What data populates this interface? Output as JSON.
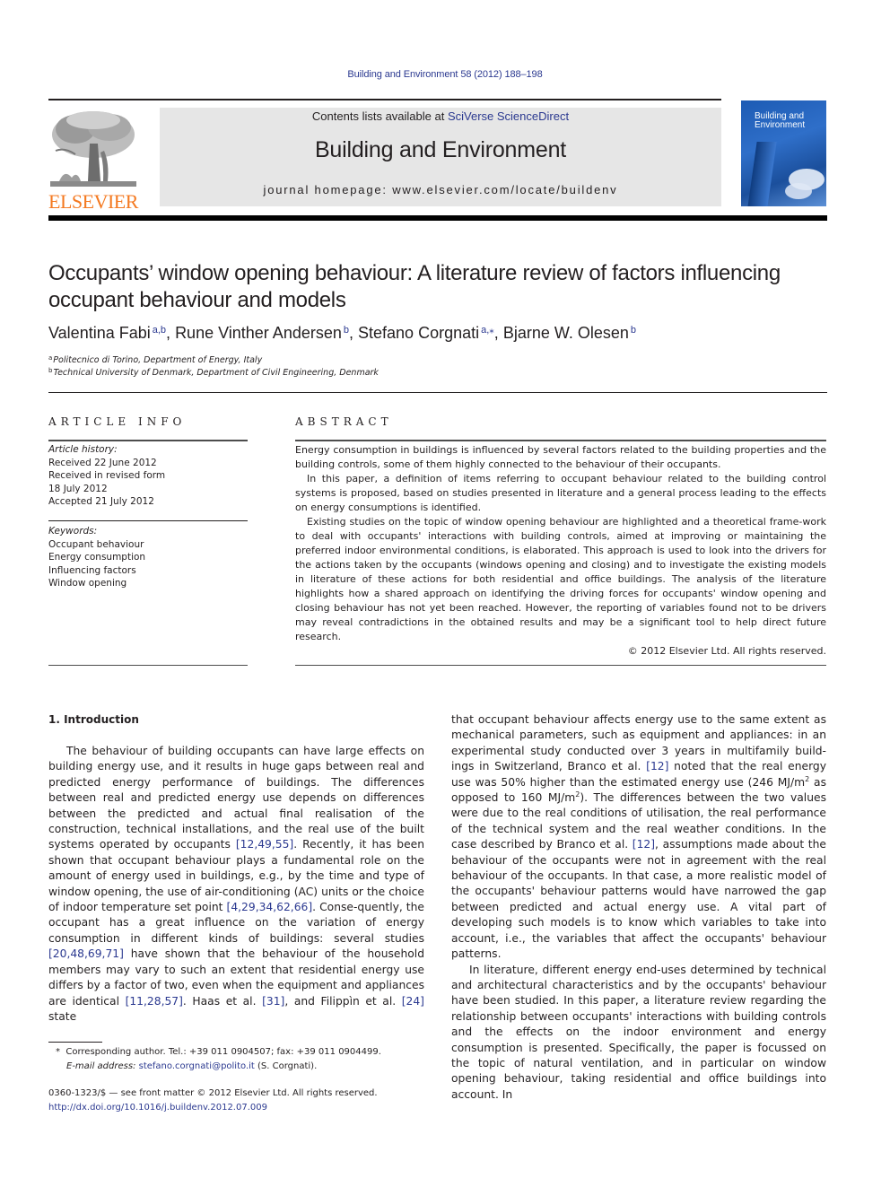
{
  "running_head": "Building and Environment 58 (2012) 188–198",
  "masthead": {
    "publisher_logo_text": "ELSEVIER",
    "contents_prefix": "Contents lists available at ",
    "contents_link": "SciVerse ScienceDirect",
    "journal_title": "Building and Environment",
    "homepage": "journal homepage: www.elsevier.com/locate/buildenv",
    "cover_title_line1": "Building and",
    "cover_title_line2": "Environment"
  },
  "article": {
    "title": "Occupants’ window opening behaviour: A literature review of factors influencing occupant behaviour and models",
    "authors": [
      {
        "name": "Valentina Fabi",
        "sup": "a,b",
        "sep": ", "
      },
      {
        "name": "Rune Vinther Andersen",
        "sup": "b",
        "sep": ", "
      },
      {
        "name": "Stefano Corgnati",
        "sup": "a,⁎",
        "sep": ", "
      },
      {
        "name": "Bjarne W. Olesen",
        "sup": "b",
        "sep": ""
      }
    ],
    "affiliations": [
      {
        "mark": "a",
        "text": "Politecnico di Torino, Department of Energy, Italy"
      },
      {
        "mark": "b",
        "text": "Technical University of Denmark, Department of Civil Engineering, Denmark"
      }
    ]
  },
  "article_info": {
    "heading": "ARTICLE INFO",
    "history_label": "Article history:",
    "history": [
      "Received 22 June 2012",
      "Received in revised form",
      "18 July 2012",
      "Accepted 21 July 2012"
    ],
    "keywords_label": "Keywords:",
    "keywords": [
      "Occupant behaviour",
      "Energy consumption",
      "Influencing factors",
      "Window opening"
    ]
  },
  "abstract": {
    "heading": "ABSTRACT",
    "paragraphs": [
      "Energy consumption in buildings is influenced by several factors related to the building properties and the building controls, some of them highly connected to the behaviour of their occupants.",
      "In this paper, a definition of items referring to occupant behaviour related to the building control systems is proposed, based on studies presented in literature and a general process leading to the effects on energy consumptions is identified.",
      "Existing studies on the topic of window opening behaviour are highlighted and a theoretical frame-work to deal with occupants' interactions with building controls, aimed at improving or maintaining the preferred indoor environmental conditions, is elaborated. This approach is used to look into the drivers for the actions taken by the occupants (windows opening and closing) and to investigate the existing models in literature of these actions for both residential and office buildings. The analysis of the literature highlights how a shared approach on identifying the driving forces for occupants' window opening and closing behaviour has not yet been reached. However, the reporting of variables found not to be drivers may reveal contradictions in the obtained results and may be a significant tool to help direct future research."
    ],
    "copyright": "© 2012 Elsevier Ltd. All rights reserved."
  },
  "body": {
    "section_title": "1.  Introduction",
    "left_col": {
      "p1_a": "The behaviour of building occupants can have large effects on building energy use, and it results in huge gaps between real and predicted energy performance of buildings. The differences between real and predicted energy use depends on differences between the predicted and actual final realisation of the construction, technical installations, and the real use of the built systems operated by occupants ",
      "ref1": "[12,49,55]",
      "p1_b": ". Recently, it has been shown that occupant behaviour plays a fundamental role on the amount of energy used in buildings, e.g., by the time and type of window opening, the use of air-conditioning (AC) units or the choice of indoor temperature set point ",
      "ref2": "[4,29,34,62,66]",
      "p1_c": ". Conse-quently, the occupant has a great influence on the variation of energy consumption in different kinds of buildings: several studies ",
      "ref3": "[20,48,69,71]",
      "p1_d": " have shown that the behaviour of the household members may vary to such an extent that residential energy use differs by a factor of two, even when the equipment and appliances are identical ",
      "ref4": "[11,28,57]",
      "p1_e": ". Haas et al. ",
      "ref5": "[31]",
      "p1_f": ", and Filippìn et al. ",
      "ref6": "[24]",
      "p1_g": " state"
    },
    "right_col": {
      "p1_a": "that occupant behaviour affects energy use to the same extent as mechanical parameters, such as equipment and appliances: in an experimental study conducted over 3 years in multifamily build-ings in Switzerland, Branco et al. ",
      "ref1": "[12]",
      "p1_b": " noted that the real energy use was 50% higher than the estimated energy use (246 MJ/m",
      "sup1": "2",
      "p1_c": " as opposed to 160 MJ/m",
      "sup2": "2",
      "p1_d": "). The differences between the two values were due to the real conditions of utilisation, the real performance of the technical system and the real weather conditions. In the case described by Branco et al. ",
      "ref2": "[12]",
      "p1_e": ", assumptions made about the behaviour of the occupants were not in agreement with the real behaviour of the occupants. In that case, a more realistic model of the occupants' behaviour patterns would have narrowed the gap between predicted and actual energy use. A vital part of developing such models is to know which variables to take into account, i.e., the variables that affect the occupants' behaviour patterns.",
      "p2": "In literature, different energy end-uses determined by technical and architectural characteristics and by the occupants' behaviour have been studied. In this paper, a literature review regarding the relationship between occupants' interactions with building controls and the effects on the indoor environment and energy consumption is presented. Specifically, the paper is focussed on the topic of natural ventilation, and in particular on window opening behaviour, taking residential and office buildings into account. In"
    }
  },
  "footnote": {
    "mark": "*",
    "text": "Corresponding author. Tel.: +39 011 0904507; fax: +39 011 0904499.",
    "email_label": "E-mail address:",
    "email": "stefano.corgnati@polito.it",
    "email_suffix": " (S. Corgnati)."
  },
  "footer": {
    "issn_line": "0360-1323/$ — see front matter © 2012 Elsevier Ltd. All rights reserved.",
    "doi": "http://dx.doi.org/10.1016/j.buildenv.2012.07.009"
  }
}
